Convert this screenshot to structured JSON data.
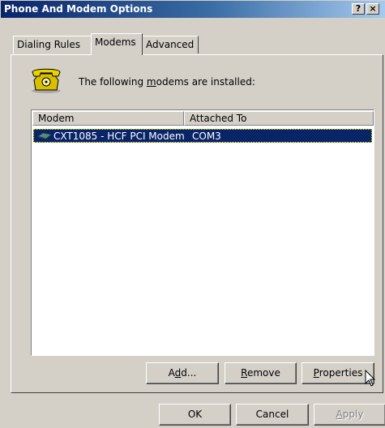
{
  "window": {
    "title": "Phone And Modem Options",
    "help_button": "?",
    "close_button": "×"
  },
  "tabs": [
    {
      "label": "Dialing Rules",
      "active": false
    },
    {
      "label": "Modems",
      "active": true
    },
    {
      "label": "Advanced",
      "active": false
    }
  ],
  "intro": {
    "before": "The following ",
    "mnemonic": "m",
    "after": "odems are  installed:",
    "icon": "phone-icon"
  },
  "modem_list": {
    "columns": [
      "Modem",
      "Attached To"
    ],
    "rows": [
      {
        "modem": "CXT1085 - HCF PCI Modem",
        "attached_to": "COM3",
        "selected": true,
        "icon": "modem-icon"
      }
    ]
  },
  "list_buttons": {
    "add": {
      "before": "A",
      "mnemonic": "d",
      "after": "d..."
    },
    "remove": {
      "before": "",
      "mnemonic": "R",
      "after": "emove"
    },
    "properties": {
      "before": "",
      "mnemonic": "P",
      "after": "roperties"
    }
  },
  "dialog_buttons": {
    "ok": "OK",
    "cancel": "Cancel",
    "apply": {
      "before": "",
      "mnemonic": "A",
      "after": "pply",
      "disabled": true
    }
  },
  "colors": {
    "title_start": "#0a246a",
    "title_end": "#a6caf0",
    "face": "#d4d0c8",
    "selection": "#0a246a"
  }
}
